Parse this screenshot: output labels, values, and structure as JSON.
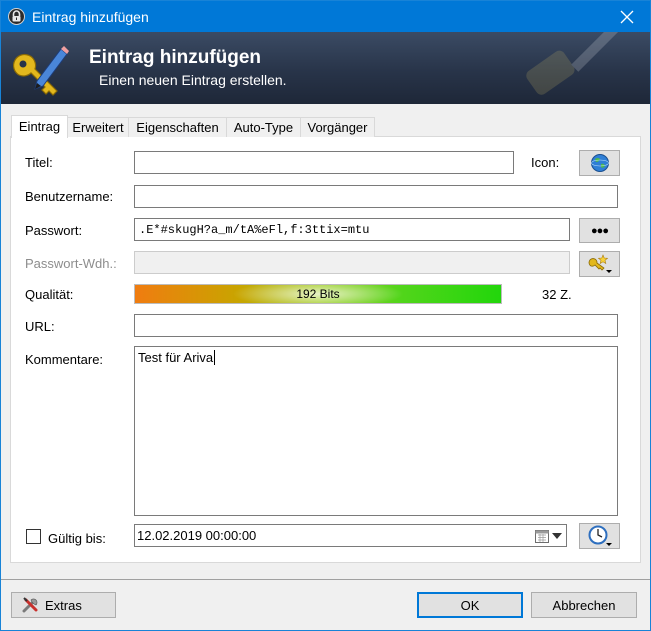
{
  "window": {
    "title": "Eintrag hinzufügen"
  },
  "banner": {
    "title": "Eintrag hinzufügen",
    "subtitle": "Einen neuen Eintrag erstellen."
  },
  "tabs": [
    {
      "label": "Eintrag",
      "active": true
    },
    {
      "label": "Erweitert",
      "active": false
    },
    {
      "label": "Eigenschaften",
      "active": false
    },
    {
      "label": "Auto-Type",
      "active": false
    },
    {
      "label": "Vorgänger",
      "active": false
    }
  ],
  "form": {
    "title_label": "Titel:",
    "title_value": "",
    "icon_label": "Icon:",
    "username_label": "Benutzername:",
    "username_value": "",
    "password_label": "Passwort:",
    "password_value": ".E*#skugH?a_m/tA%eFl,f:3ttix=mtu",
    "password_reveal_label": "●●●",
    "repeat_label": "Passwort-Wdh.:",
    "repeat_value": "",
    "quality_label": "Qualität:",
    "quality_text": "192 Bits",
    "quality_fraction": 1.0,
    "char_count": "32 Z.",
    "url_label": "URL:",
    "url_value": "",
    "comments_label": "Kommentare:",
    "comments_value": "Test für Ariva",
    "expires_label": "Gültig bis:",
    "expires_checked": false,
    "expires_value": "12.02.2019 00:00:00"
  },
  "footer": {
    "tools_label": "Extras",
    "ok_label": "OK",
    "cancel_label": "Abbrechen"
  },
  "colors": {
    "titlebar": "#0078d7",
    "banner": "#283449",
    "accent": "#0078d7"
  },
  "icons": {
    "app": "keepass-lock-icon",
    "banner": "key-pencil-icon",
    "entry_icon": "globe-icon",
    "password_generator": "key-star-icon",
    "expiry_presets": "clock-icon",
    "date_picker": "calendar-icon",
    "tools": "wrench-screwdriver-icon",
    "close": "close-icon"
  }
}
